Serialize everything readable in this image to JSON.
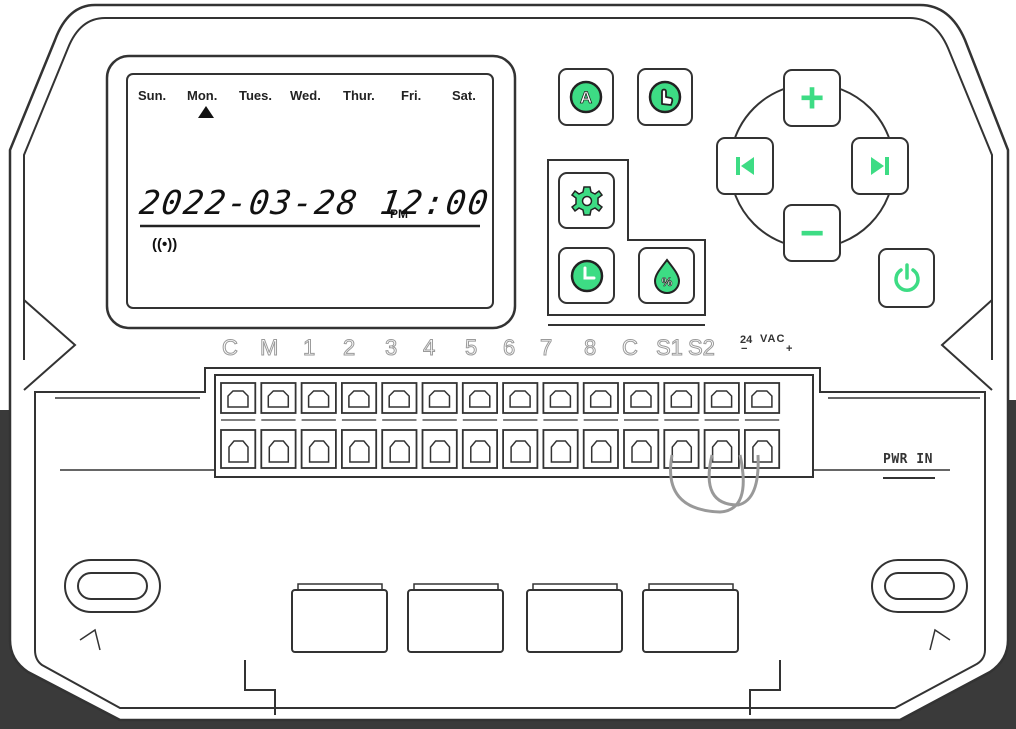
{
  "display": {
    "days": [
      "Sun.",
      "Mon.",
      "Tues.",
      "Wed.",
      "Thur.",
      "Fri.",
      "Sat."
    ],
    "selected_day": "Mon.",
    "datetime": "2022-03-28 12:00",
    "ampm": "PM",
    "wifi_symbol": "((•))"
  },
  "buttons": {
    "auto": "A",
    "manual": "hand-pointer-icon",
    "settings": "gear-icon",
    "clock": "clock-icon",
    "water_percent": "%",
    "plus": "+",
    "minus": "−",
    "prev": "skip-previous-icon",
    "next": "skip-next-icon",
    "power": "power-icon"
  },
  "terminals": [
    "C",
    "M",
    "1",
    "2",
    "3",
    "4",
    "5",
    "6",
    "7",
    "8",
    "C",
    "S1",
    "S2"
  ],
  "vac_label": {
    "num": "24",
    "text": "VAC",
    "minus": "−",
    "plus": "+"
  },
  "pwr_label": "PWR IN",
  "colors": {
    "accent": "#3ddc84",
    "outline": "#333333",
    "dark_bg": "#3a3a3a"
  }
}
